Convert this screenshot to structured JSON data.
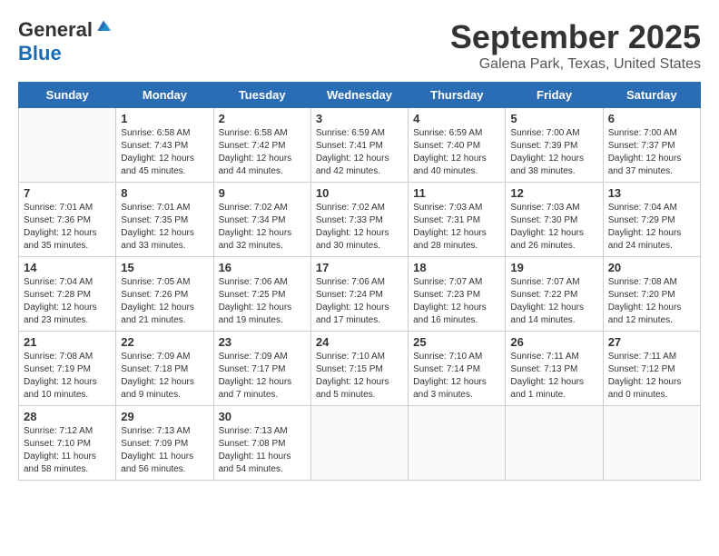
{
  "header": {
    "logo_general": "General",
    "logo_blue": "Blue",
    "month_title": "September 2025",
    "location": "Galena Park, Texas, United States"
  },
  "weekdays": [
    "Sunday",
    "Monday",
    "Tuesday",
    "Wednesday",
    "Thursday",
    "Friday",
    "Saturday"
  ],
  "weeks": [
    [
      {
        "day": "",
        "info": ""
      },
      {
        "day": "1",
        "info": "Sunrise: 6:58 AM\nSunset: 7:43 PM\nDaylight: 12 hours\nand 45 minutes."
      },
      {
        "day": "2",
        "info": "Sunrise: 6:58 AM\nSunset: 7:42 PM\nDaylight: 12 hours\nand 44 minutes."
      },
      {
        "day": "3",
        "info": "Sunrise: 6:59 AM\nSunset: 7:41 PM\nDaylight: 12 hours\nand 42 minutes."
      },
      {
        "day": "4",
        "info": "Sunrise: 6:59 AM\nSunset: 7:40 PM\nDaylight: 12 hours\nand 40 minutes."
      },
      {
        "day": "5",
        "info": "Sunrise: 7:00 AM\nSunset: 7:39 PM\nDaylight: 12 hours\nand 38 minutes."
      },
      {
        "day": "6",
        "info": "Sunrise: 7:00 AM\nSunset: 7:37 PM\nDaylight: 12 hours\nand 37 minutes."
      }
    ],
    [
      {
        "day": "7",
        "info": "Sunrise: 7:01 AM\nSunset: 7:36 PM\nDaylight: 12 hours\nand 35 minutes."
      },
      {
        "day": "8",
        "info": "Sunrise: 7:01 AM\nSunset: 7:35 PM\nDaylight: 12 hours\nand 33 minutes."
      },
      {
        "day": "9",
        "info": "Sunrise: 7:02 AM\nSunset: 7:34 PM\nDaylight: 12 hours\nand 32 minutes."
      },
      {
        "day": "10",
        "info": "Sunrise: 7:02 AM\nSunset: 7:33 PM\nDaylight: 12 hours\nand 30 minutes."
      },
      {
        "day": "11",
        "info": "Sunrise: 7:03 AM\nSunset: 7:31 PM\nDaylight: 12 hours\nand 28 minutes."
      },
      {
        "day": "12",
        "info": "Sunrise: 7:03 AM\nSunset: 7:30 PM\nDaylight: 12 hours\nand 26 minutes."
      },
      {
        "day": "13",
        "info": "Sunrise: 7:04 AM\nSunset: 7:29 PM\nDaylight: 12 hours\nand 24 minutes."
      }
    ],
    [
      {
        "day": "14",
        "info": "Sunrise: 7:04 AM\nSunset: 7:28 PM\nDaylight: 12 hours\nand 23 minutes."
      },
      {
        "day": "15",
        "info": "Sunrise: 7:05 AM\nSunset: 7:26 PM\nDaylight: 12 hours\nand 21 minutes."
      },
      {
        "day": "16",
        "info": "Sunrise: 7:06 AM\nSunset: 7:25 PM\nDaylight: 12 hours\nand 19 minutes."
      },
      {
        "day": "17",
        "info": "Sunrise: 7:06 AM\nSunset: 7:24 PM\nDaylight: 12 hours\nand 17 minutes."
      },
      {
        "day": "18",
        "info": "Sunrise: 7:07 AM\nSunset: 7:23 PM\nDaylight: 12 hours\nand 16 minutes."
      },
      {
        "day": "19",
        "info": "Sunrise: 7:07 AM\nSunset: 7:22 PM\nDaylight: 12 hours\nand 14 minutes."
      },
      {
        "day": "20",
        "info": "Sunrise: 7:08 AM\nSunset: 7:20 PM\nDaylight: 12 hours\nand 12 minutes."
      }
    ],
    [
      {
        "day": "21",
        "info": "Sunrise: 7:08 AM\nSunset: 7:19 PM\nDaylight: 12 hours\nand 10 minutes."
      },
      {
        "day": "22",
        "info": "Sunrise: 7:09 AM\nSunset: 7:18 PM\nDaylight: 12 hours\nand 9 minutes."
      },
      {
        "day": "23",
        "info": "Sunrise: 7:09 AM\nSunset: 7:17 PM\nDaylight: 12 hours\nand 7 minutes."
      },
      {
        "day": "24",
        "info": "Sunrise: 7:10 AM\nSunset: 7:15 PM\nDaylight: 12 hours\nand 5 minutes."
      },
      {
        "day": "25",
        "info": "Sunrise: 7:10 AM\nSunset: 7:14 PM\nDaylight: 12 hours\nand 3 minutes."
      },
      {
        "day": "26",
        "info": "Sunrise: 7:11 AM\nSunset: 7:13 PM\nDaylight: 12 hours\nand 1 minute."
      },
      {
        "day": "27",
        "info": "Sunrise: 7:11 AM\nSunset: 7:12 PM\nDaylight: 12 hours\nand 0 minutes."
      }
    ],
    [
      {
        "day": "28",
        "info": "Sunrise: 7:12 AM\nSunset: 7:10 PM\nDaylight: 11 hours\nand 58 minutes."
      },
      {
        "day": "29",
        "info": "Sunrise: 7:13 AM\nSunset: 7:09 PM\nDaylight: 11 hours\nand 56 minutes."
      },
      {
        "day": "30",
        "info": "Sunrise: 7:13 AM\nSunset: 7:08 PM\nDaylight: 11 hours\nand 54 minutes."
      },
      {
        "day": "",
        "info": ""
      },
      {
        "day": "",
        "info": ""
      },
      {
        "day": "",
        "info": ""
      },
      {
        "day": "",
        "info": ""
      }
    ]
  ]
}
